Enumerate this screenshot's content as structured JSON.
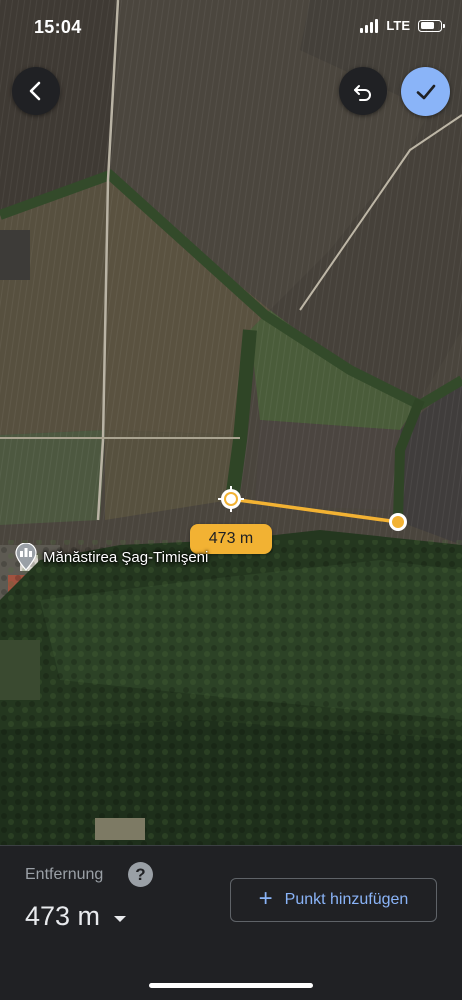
{
  "status_bar": {
    "time": "15:04",
    "network": "LTE",
    "battery_fraction": 0.75,
    "icons": [
      "signal-icon",
      "battery-icon"
    ]
  },
  "map": {
    "type": "satellite",
    "place_name": "Mănăstirea Şag-Timişeni",
    "place_icon": "monastery-icon",
    "measure_label": "473 m",
    "measure_line_color": "#f2b233",
    "controls": {
      "back_icon": "chevron-left-icon",
      "undo_icon": "undo-icon",
      "done_icon": "check-icon",
      "done_color": "#8ab4f8"
    }
  },
  "panel": {
    "distance_label": "Entfernung",
    "help_icon_text": "?",
    "distance_value": "473 m",
    "add_point_label": "Punkt hinzufügen",
    "add_point_icon": "plus-icon",
    "accent": "#8ab4f8"
  }
}
